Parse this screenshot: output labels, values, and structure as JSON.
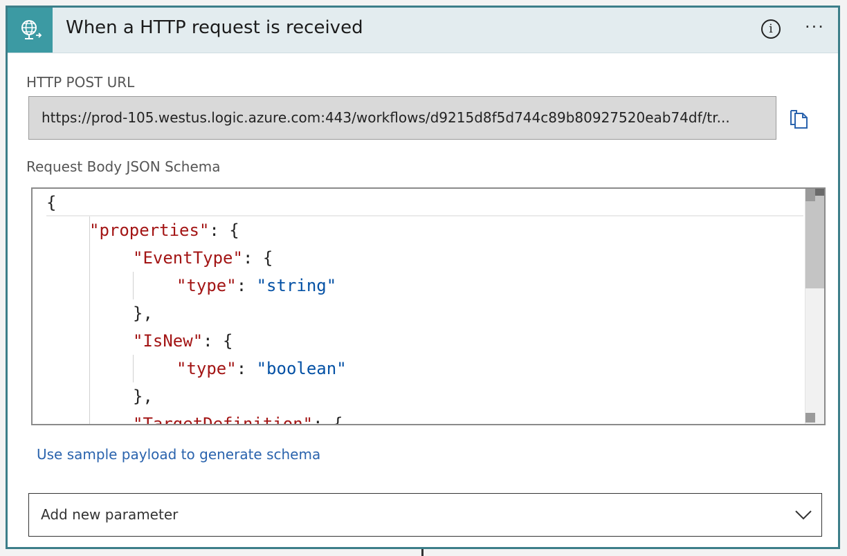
{
  "trigger": {
    "title": "When a HTTP request is received",
    "icon": "globe-request-icon",
    "info_icon": "info-icon",
    "more_label": "···"
  },
  "url_section": {
    "label": "HTTP POST URL",
    "value": "https://prod-105.westus.logic.azure.com:443/workflows/d9215d8f5d744c89b80927520eab74df/tr...",
    "copy_icon": "copy-icon"
  },
  "schema_section": {
    "label": "Request Body JSON Schema",
    "lines": [
      "{",
      "\"properties\": {",
      "\"EventType\": {",
      "\"type\": \"string\"",
      "},",
      "\"IsNew\": {",
      "\"type\": \"boolean\"",
      "},",
      "\"TargetDefinition\": {"
    ]
  },
  "sample_link": "Use sample payload to generate schema",
  "add_param": {
    "label": "Add new parameter",
    "icon": "chevron-down-icon"
  },
  "colors": {
    "accent": "#3c7e89",
    "icon_bg": "#3c9aa3",
    "header_bg": "#e3ecef",
    "json_key": "#a31515",
    "json_string": "#0451a5",
    "link": "#2a63ad"
  }
}
